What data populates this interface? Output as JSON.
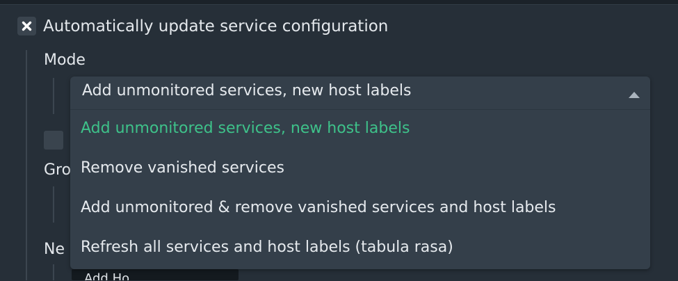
{
  "option": {
    "checkbox_icon": "close-x-icon",
    "label": "Automatically update service configuration",
    "mode_label": "Mode"
  },
  "background_fragments": {
    "group_label_partial": "Gro",
    "new_label_partial": "Ne",
    "field_partial_text": "Add Ho"
  },
  "mode_select": {
    "selected_value": "Add unmonitored services, new host labels",
    "caret_icon": "caret-up-icon",
    "options": [
      {
        "label": "Add unmonitored services, new host labels",
        "selected": true
      },
      {
        "label": "Remove vanished services",
        "selected": false
      },
      {
        "label": "Add unmonitored & remove vanished services and host labels",
        "selected": false
      },
      {
        "label": "Refresh all services and host labels (tabula rasa)",
        "selected": false
      }
    ]
  },
  "colors": {
    "background": "#262f38",
    "dropdown": "#343f4a",
    "selected_option": "#3ec28a",
    "text": "#e6eaee"
  }
}
